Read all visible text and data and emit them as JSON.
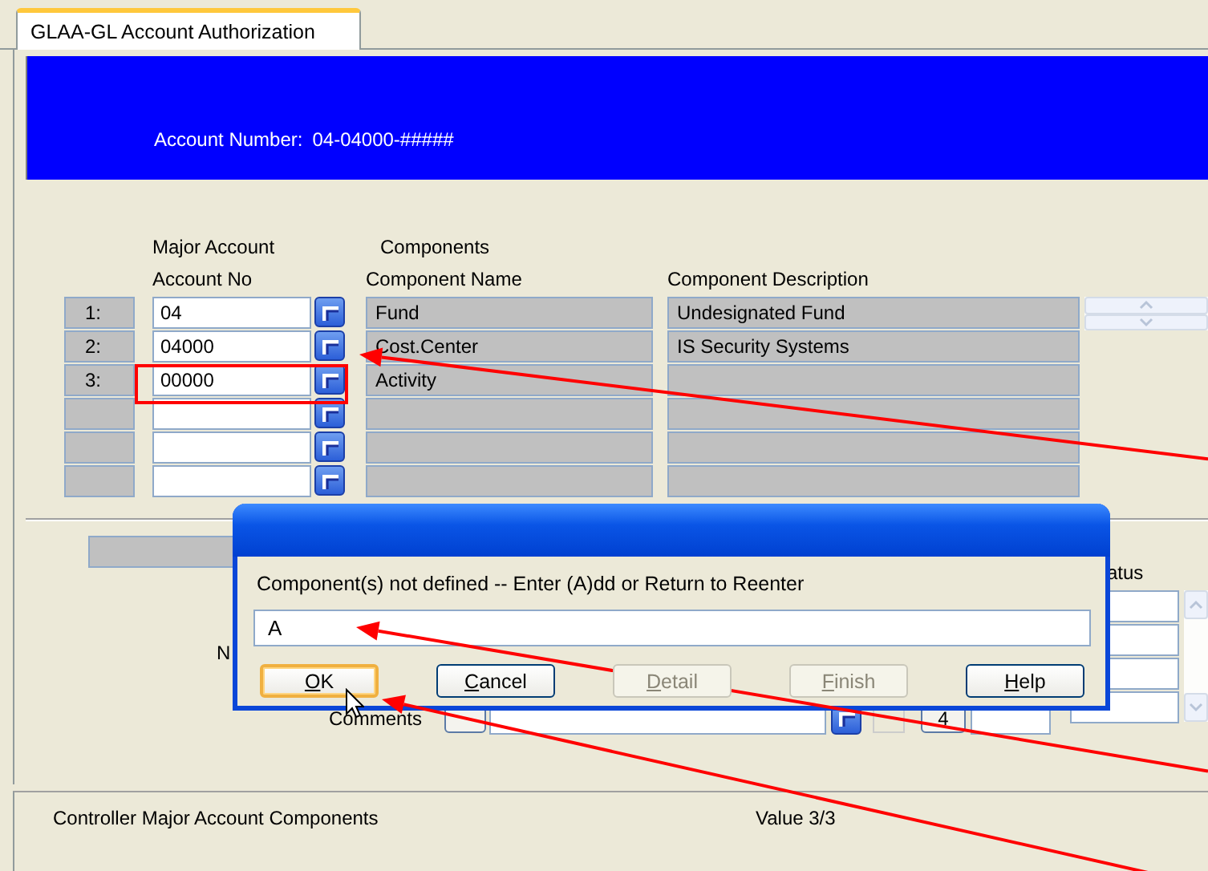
{
  "tab": {
    "label": "GLAA-GL Account Authorization",
    "selected": true
  },
  "header": {
    "account_number_label": "Account Number:",
    "account_number": "04-04000-#####"
  },
  "grid": {
    "group_headings": [
      "Major Account",
      "Components"
    ],
    "columns": [
      "Account No",
      "Component Name",
      "Component Description"
    ],
    "rows": [
      {
        "number": "1:",
        "account_no": "04",
        "component_name": "Fund",
        "component_description": "Undesignated Fund"
      },
      {
        "number": "2:",
        "account_no": "04000",
        "component_name": "Cost.Center",
        "component_description": "IS Security Systems"
      },
      {
        "number": "3:",
        "account_no": "00000",
        "component_name": "Activity",
        "highlighted": true
      },
      {},
      {},
      {}
    ]
  },
  "lower_form": {
    "label_1": "N",
    "comments_label": "Comments",
    "count": "4",
    "column_heading": "atus"
  },
  "dialog": {
    "message": "Component(s) not defined --  Enter (A)dd or Return to Reenter",
    "value": "A",
    "buttons": [
      {
        "key": "O",
        "after": "K",
        "disabled": false,
        "default": true
      },
      {
        "key": "C",
        "after": "ancel",
        "disabled": false,
        "default": false
      },
      {
        "key": "D",
        "after": "etail",
        "disabled": true,
        "default": false
      },
      {
        "key": "F",
        "after": "inish",
        "disabled": true,
        "default": false
      },
      {
        "key": "H",
        "after": "elp",
        "disabled": false,
        "default": false
      }
    ]
  },
  "status_bar": {
    "left": "Controller Major Account Components",
    "right": "Value 3/3"
  }
}
